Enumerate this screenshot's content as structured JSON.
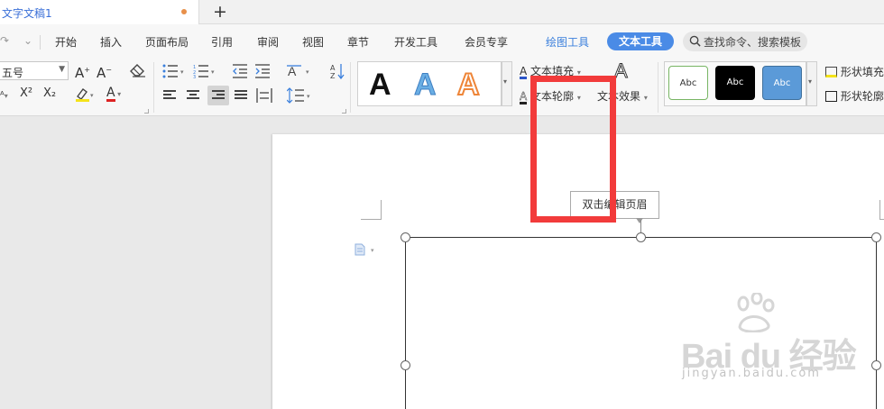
{
  "tabbar": {
    "doc_title": "文字文稿1",
    "new_tab_symbol": "+"
  },
  "menu": {
    "redo_symbol": "↷",
    "more_symbol": "⌄",
    "items": [
      "开始",
      "插入",
      "页面布局",
      "引用",
      "审阅",
      "视图",
      "章节",
      "开发工具",
      "会员专享",
      "绘图工具"
    ],
    "active_tab": "文本工具",
    "search_text": "查找命令、搜索模板"
  },
  "ribbon": {
    "font_size": "五号",
    "art_letter": "A",
    "text_fill": "文本填充",
    "text_outline": "文本轮廓",
    "text_effect": "文本效果",
    "shape_sample": "Abc",
    "shape_fill": "形状填充",
    "shape_outline": "形状轮廓",
    "grow_font": "A",
    "shrink_font": "A",
    "superscript": "X²",
    "subscript": "X₂",
    "font_color_letter": "A"
  },
  "document": {
    "header_tip": "双击编辑页眉"
  },
  "watermark": {
    "brand": "Bai du 经验",
    "url": "jingyan.baidu.com"
  },
  "colors": {
    "accent": "#4a8be6",
    "highlight_box": "#f23b3b",
    "tab_title": "#3a6fd8"
  }
}
